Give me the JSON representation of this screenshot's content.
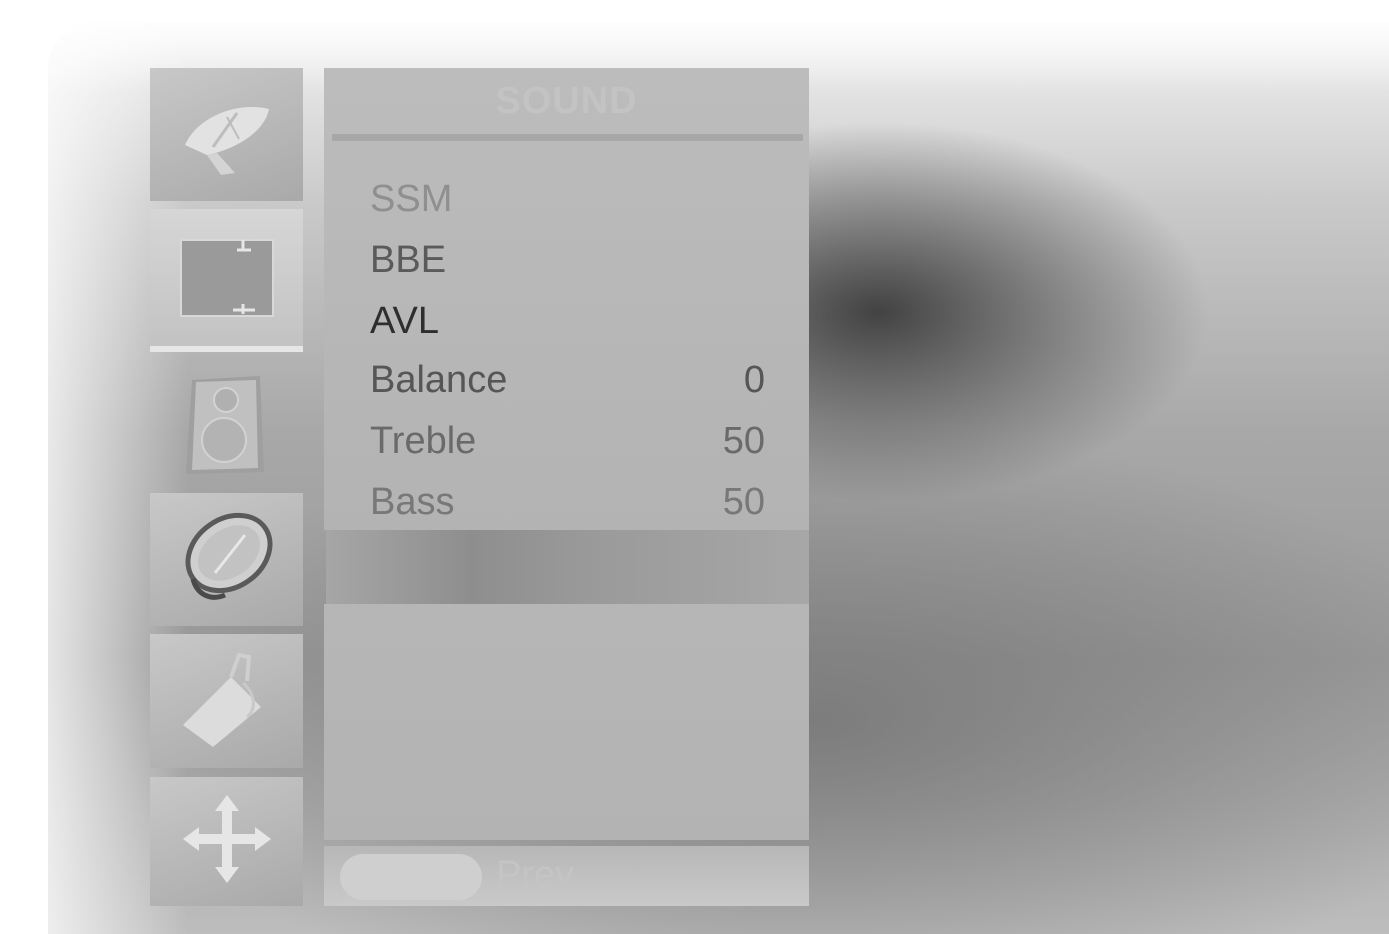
{
  "menu": {
    "title": "SOUND",
    "items": [
      {
        "label": "SSM",
        "value": "",
        "color": "#8f8f8f"
      },
      {
        "label": "BBE",
        "value": "",
        "color": "#5a5a5a"
      },
      {
        "label": "AVL",
        "value": "",
        "color": "#2e2e2e"
      },
      {
        "label": "Balance",
        "value": "0",
        "color": "#565656"
      },
      {
        "label": "Treble",
        "value": "50",
        "color": "#6a6a6a"
      },
      {
        "label": "Bass",
        "value": "50",
        "color": "#787878"
      }
    ]
  },
  "footer": {
    "prev_label": "Prev."
  },
  "sidebar": {
    "icons": [
      {
        "name": "satellite-dish-icon"
      },
      {
        "name": "picture-icon"
      },
      {
        "name": "speaker-icon"
      },
      {
        "name": "clock-icon"
      },
      {
        "name": "tools-icon"
      },
      {
        "name": "move-arrows-icon"
      }
    ],
    "selected_index": 1
  }
}
